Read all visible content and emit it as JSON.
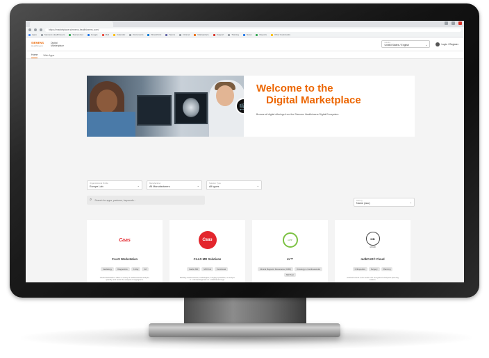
{
  "browser": {
    "url": "https://marketplace.siemens-healthineers.com/",
    "bookmarks": [
      "Apps",
      "Siemens Healthineers",
      "Teamcenter",
      "Google",
      "Mail",
      "Calendar",
      "Documents",
      "SharePoint",
      "Teams",
      "Intranet",
      "Marketplace",
      "Support",
      "Training",
      "News",
      "Reports",
      "Other bookmarks"
    ],
    "bookmark_colors": [
      "#4285f4",
      "#9aa0a6",
      "#34a853",
      "#1a73e8",
      "#ea4335",
      "#fbbc04",
      "#9aa0a6",
      "#0078d4",
      "#6264a7",
      "#9aa0a6",
      "#ec6602",
      "#d93025",
      "#9aa0a6",
      "#1a73e8",
      "#34a853",
      "#fbbc04"
    ]
  },
  "header": {
    "logo_top": "SIEMENS",
    "logo_bottom": "Healthineers",
    "app_name_1": "Digital",
    "app_name_2": "Marketplace",
    "country_label": "Country",
    "country_value": "United States / English",
    "login": "Login / Register"
  },
  "subnav": {
    "tabs": [
      "Home",
      "Web Apps"
    ]
  },
  "hero": {
    "title_line1": "Welcome to the",
    "title_line2": "Digital Marketplace",
    "subtitle": "Browse all digital offerings from the Siemens Healthineers Digital Ecosystem"
  },
  "filters": [
    {
      "label": "Organizational Profile",
      "value": "Europe Lab"
    },
    {
      "label": "Manufacturer",
      "value": "All Manufacturers"
    },
    {
      "label": "Solution Type",
      "value": "All types"
    }
  ],
  "search": {
    "placeholder": "Search for apps, partners, keywords..."
  },
  "sort": {
    "label": "Sort by",
    "value": "Name (asc)"
  },
  "cards": [
    {
      "logo": "Caas",
      "title": "CAAS Workstation",
      "tags": [
        "Cardiology",
        "Diagnostics",
        "X-Ray",
        "AX"
      ],
      "desc": "CAAS Workstation. Offers a variety of cardiovascular analysis, quantify, and assist the analysis of angiograms."
    },
    {
      "logo": "Caas",
      "title": "CAAS MR Solutions",
      "tags": [
        "Cardio MR",
        "MR Post",
        "Functional"
      ],
      "desc": "Building cardiovascular, cardiologists, imaging specialists, to analyze in a clinical diagnosis on a dedicated image."
    },
    {
      "logo": "mTP",
      "title": "m²ᵀᴾ",
      "tags": [
        "Clinical Magnetic Resonance (CMR)",
        "Oncology & Cardiovascular",
        "MR Post"
      ],
      "desc": "m²ᵀᴾ is a software for the quick processing software for viewing and analyzing CMR images."
    },
    {
      "logo": "mbCAD",
      "title": "mdbCAD® Cloud",
      "tags": [
        "Orthopedics",
        "Surgery",
        "Planning"
      ],
      "desc": "mdbCAD Cloud is the world most recognized orthopedic planning solution."
    }
  ]
}
